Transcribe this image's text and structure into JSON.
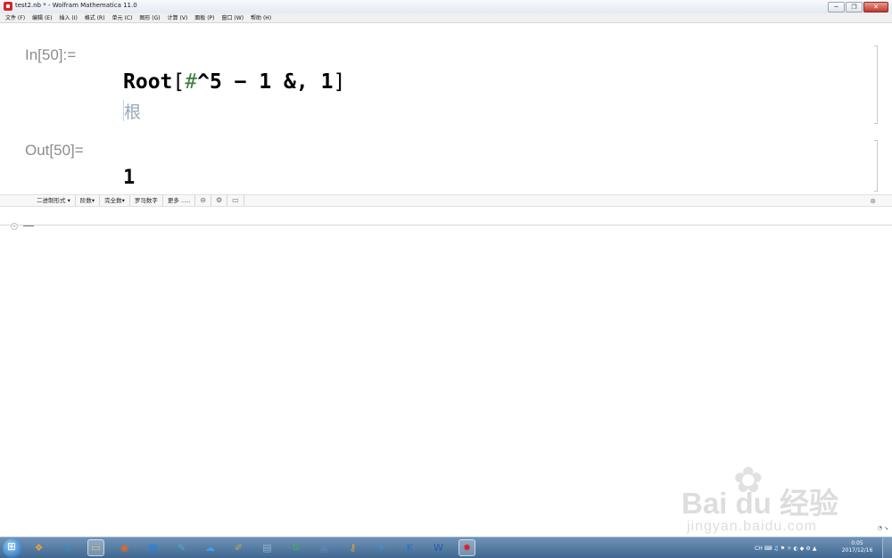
{
  "window": {
    "title": "test2.nb * - Wolfram Mathematica 11.0",
    "buttons": [
      "─",
      "❐",
      "✕"
    ]
  },
  "menubar": {
    "items": [
      "文件 (F)",
      "编辑 (E)",
      "插入 (I)",
      "格式 (R)",
      "单元 (C)",
      "图形 (G)",
      "计算 (V)",
      "面板 (P)",
      "窗口 (W)",
      "帮助 (H)"
    ]
  },
  "notebook": {
    "input_label": "In[50]:=",
    "input_parts": {
      "head": "Root",
      "open": "[",
      "slot": "#",
      "rest": "^5 − 1 &, 1",
      "close": "]"
    },
    "hint": "根",
    "output_label": "Out[50]=",
    "output_value": "1"
  },
  "suggestions": {
    "items": [
      "二进制形式 ▾",
      "阶数▾",
      "完全数▾",
      "罗马数字",
      "更多 ....."
    ],
    "icons": [
      "zoom-icon",
      "gear-icon",
      "comment-icon"
    ],
    "icon_glyphs": [
      "⊖",
      "⚙",
      "▭"
    ],
    "close_glyph": "⊗"
  },
  "cell_insert": "+",
  "statusbar": {
    "glyphs": [
      "◔",
      "↘"
    ]
  },
  "watermark": {
    "text": "Bai du 经验",
    "url": "jingyan.baidu.com"
  },
  "taskbar": {
    "apps": [
      {
        "icon": "windows-logo-icon",
        "glyph": "❖",
        "color": "#e8a13a"
      },
      {
        "icon": "ie-icon",
        "glyph": "e",
        "color": "#2b8fd8"
      },
      {
        "icon": "folder-icon",
        "glyph": "▭",
        "color": "#e8c46a",
        "active": true
      },
      {
        "icon": "firefox-icon",
        "glyph": "◉",
        "color": "#e66a1e"
      },
      {
        "icon": "grid-app-icon",
        "glyph": "▦",
        "color": "#2a7fd4"
      },
      {
        "icon": "pen-icon",
        "glyph": "✎",
        "color": "#5aa7c8"
      },
      {
        "icon": "cloud-icon",
        "glyph": "☁",
        "color": "#39a3e6"
      },
      {
        "icon": "paint-icon",
        "glyph": "✐",
        "color": "#c9a45a"
      },
      {
        "icon": "document-icon",
        "glyph": "▤",
        "color": "#8fb3d6"
      },
      {
        "icon": "refresh-icon",
        "glyph": "↻",
        "color": "#3cb44b"
      },
      {
        "icon": "computer-icon",
        "glyph": "▣",
        "color": "#5d84ad"
      },
      {
        "icon": "key-icon",
        "glyph": "⚷",
        "color": "#e0a030"
      },
      {
        "icon": "bird-icon",
        "glyph": "✈",
        "color": "#3a8fd8"
      },
      {
        "icon": "k-icon",
        "glyph": "K",
        "color": "#2b6fc0"
      },
      {
        "icon": "word-icon",
        "glyph": "W",
        "color": "#2a5aa8"
      },
      {
        "icon": "mathematica-icon",
        "glyph": "✹",
        "color": "#d62626",
        "active": true
      }
    ],
    "tray": [
      "CH",
      "⌨",
      "♫",
      "⚑",
      "☼",
      "◐",
      "◆",
      "⚙",
      "▲"
    ],
    "time": "0:05",
    "date": "2017/12/16"
  }
}
